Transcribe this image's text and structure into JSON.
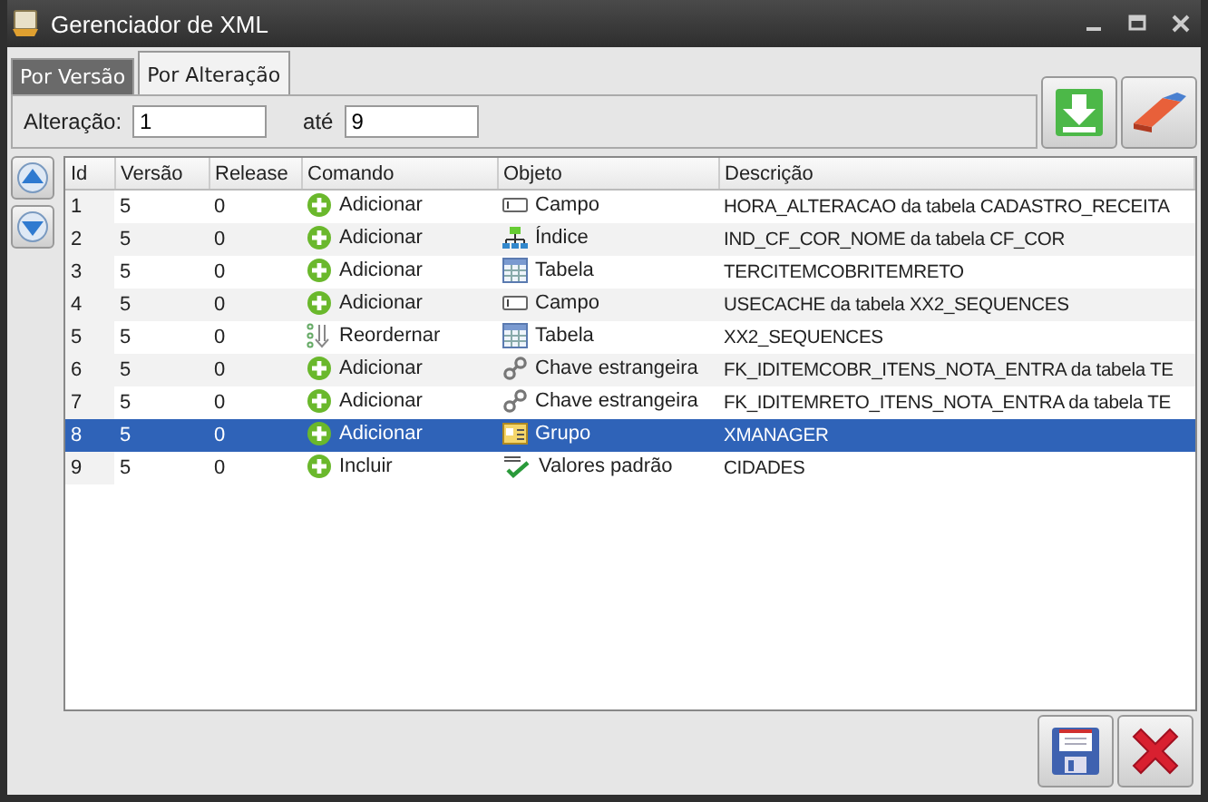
{
  "window": {
    "title": "Gerenciador de XML"
  },
  "tabs": [
    {
      "label": "Por Versão",
      "selected": false
    },
    {
      "label": "Por Alteração",
      "selected": true
    }
  ],
  "filter": {
    "from_label": "Alteração:",
    "from_value": "1",
    "to_label": "até",
    "to_value": "9"
  },
  "table": {
    "columns": [
      "Id",
      "Versão",
      "Release",
      "Comando",
      "Objeto",
      "Descrição"
    ],
    "rows": [
      {
        "id": "1",
        "version": "5",
        "release": "0",
        "command": {
          "kind": "add",
          "label": "Adicionar"
        },
        "object": {
          "kind": "field",
          "label": "Campo"
        },
        "description": "HORA_ALTERACAO da tabela CADASTRO_RECEITA",
        "selected": false
      },
      {
        "id": "2",
        "version": "5",
        "release": "0",
        "command": {
          "kind": "add",
          "label": "Adicionar"
        },
        "object": {
          "kind": "index",
          "label": "Índice"
        },
        "description": "IND_CF_COR_NOME da tabela CF_COR",
        "selected": false
      },
      {
        "id": "3",
        "version": "5",
        "release": "0",
        "command": {
          "kind": "add",
          "label": "Adicionar"
        },
        "object": {
          "kind": "table",
          "label": "Tabela"
        },
        "description": "TERCITEMCOBRITEMRETO",
        "selected": false
      },
      {
        "id": "4",
        "version": "5",
        "release": "0",
        "command": {
          "kind": "add",
          "label": "Adicionar"
        },
        "object": {
          "kind": "field",
          "label": "Campo"
        },
        "description": "USECACHE da tabela XX2_SEQUENCES",
        "selected": false
      },
      {
        "id": "5",
        "version": "5",
        "release": "0",
        "command": {
          "kind": "reorder",
          "label": "Reordernar"
        },
        "object": {
          "kind": "table",
          "label": "Tabela"
        },
        "description": "XX2_SEQUENCES",
        "selected": false
      },
      {
        "id": "6",
        "version": "5",
        "release": "0",
        "command": {
          "kind": "add",
          "label": "Adicionar"
        },
        "object": {
          "kind": "foreign_key",
          "label": "Chave estrangeira"
        },
        "description": "FK_IDITEMCOBR_ITENS_NOTA_ENTRA da tabela TE",
        "selected": false
      },
      {
        "id": "7",
        "version": "5",
        "release": "0",
        "command": {
          "kind": "add",
          "label": "Adicionar"
        },
        "object": {
          "kind": "foreign_key",
          "label": "Chave estrangeira"
        },
        "description": "FK_IDITEMRETO_ITENS_NOTA_ENTRA da tabela TE",
        "selected": false
      },
      {
        "id": "8",
        "version": "5",
        "release": "0",
        "command": {
          "kind": "add",
          "label": "Adicionar"
        },
        "object": {
          "kind": "group",
          "label": "Grupo"
        },
        "description": "XMANAGER",
        "selected": true
      },
      {
        "id": "9",
        "version": "5",
        "release": "0",
        "command": {
          "kind": "add",
          "label": "Incluir"
        },
        "object": {
          "kind": "defaults",
          "label": "Valores padrão"
        },
        "description": "CIDADES",
        "selected": false
      }
    ]
  }
}
